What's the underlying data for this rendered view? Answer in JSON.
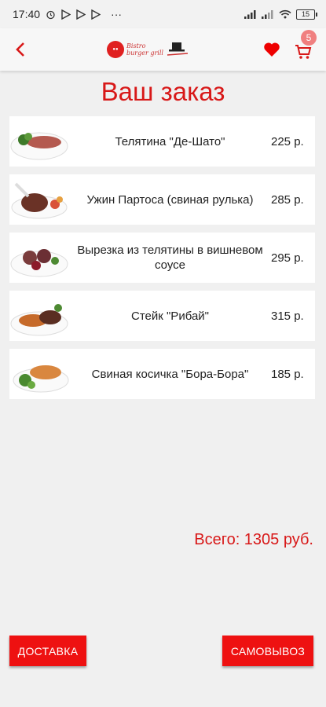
{
  "status_bar": {
    "time": "17:40",
    "dots": "···",
    "battery": "15"
  },
  "header": {
    "logo_text_top": "Bistro",
    "logo_text_bottom": "burger grill",
    "cart_count": "5"
  },
  "page_title": "Ваш заказ",
  "items": [
    {
      "name": "Телятина \"Де-Шато\"",
      "price": "225 р."
    },
    {
      "name": "Ужин Партоса (свиная рулька)",
      "price": "285 р."
    },
    {
      "name": "Вырезка из телятины в вишневом соусе",
      "price": "295 р."
    },
    {
      "name": "Стейк \"Рибай\"",
      "price": "315 р."
    },
    {
      "name": "Свиная косичка \"Бора-Бора\"",
      "price": "185 р."
    }
  ],
  "total": "Всего: 1305 руб.",
  "buttons": {
    "delivery": "ДОСТАВКА",
    "pickup": "САМОВЫВОЗ"
  },
  "colors": {
    "accent": "#d81818",
    "button": "#ee1111"
  },
  "icons": {
    "back": "chevron-left-icon",
    "favorite": "heart-icon",
    "cart": "cart-icon"
  }
}
